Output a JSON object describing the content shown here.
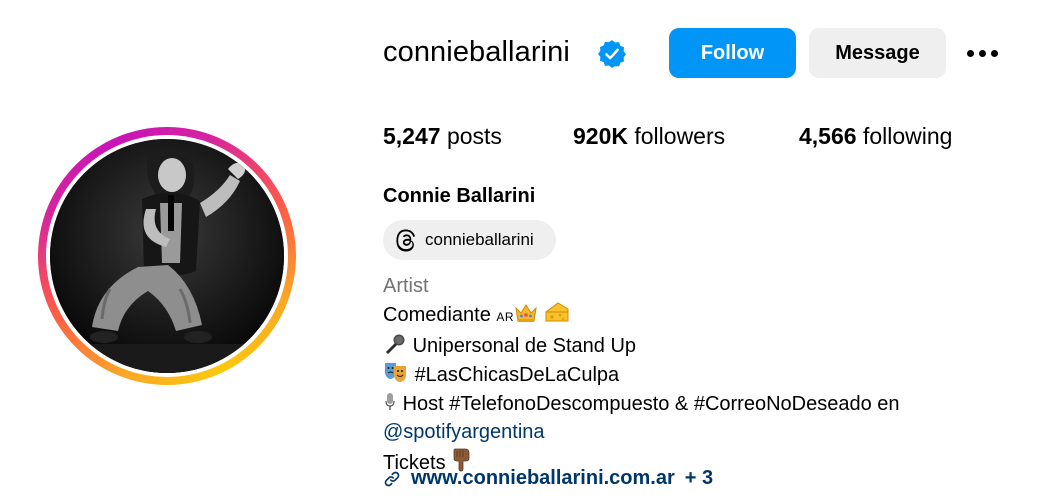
{
  "profile": {
    "username": "connieballarini",
    "verified": true,
    "full_name": "Connie Ballarini",
    "threads_handle": "connieballarini"
  },
  "actions": {
    "follow_label": "Follow",
    "message_label": "Message"
  },
  "stats": {
    "posts_count": "5,247",
    "posts_label": "posts",
    "followers_count": "920K",
    "followers_label": "followers",
    "following_count": "4,566",
    "following_label": "following"
  },
  "bio": {
    "category": "Artist",
    "line1_text": "Comediante ",
    "line1_flag": "AR",
    "line2_text": "Unipersonal de Stand Up",
    "line3_text": "#LasChicasDeLaCulpa",
    "line4_text": "Host #TelefonoDescompuesto & #CorreoNoDeseado en",
    "line5_mention": "@spotifyargentina",
    "line6_text": "Tickets"
  },
  "link": {
    "url_text": "www.connieballarini.com.ar",
    "extra_text": "+ 3"
  },
  "colors": {
    "follow_blue": "#0095f6",
    "verified_blue": "#0095f6",
    "link_blue": "#00376b",
    "category_gray": "#737373",
    "chip_gray": "#efefef"
  },
  "icons": [
    "verified-badge-icon",
    "more-options-icon",
    "threads-icon",
    "crown-emoji",
    "cheese-emoji",
    "microphone-emoji",
    "theater-masks-emoji",
    "studio-microphone-emoji",
    "pointing-down-emoji",
    "link-icon"
  ]
}
